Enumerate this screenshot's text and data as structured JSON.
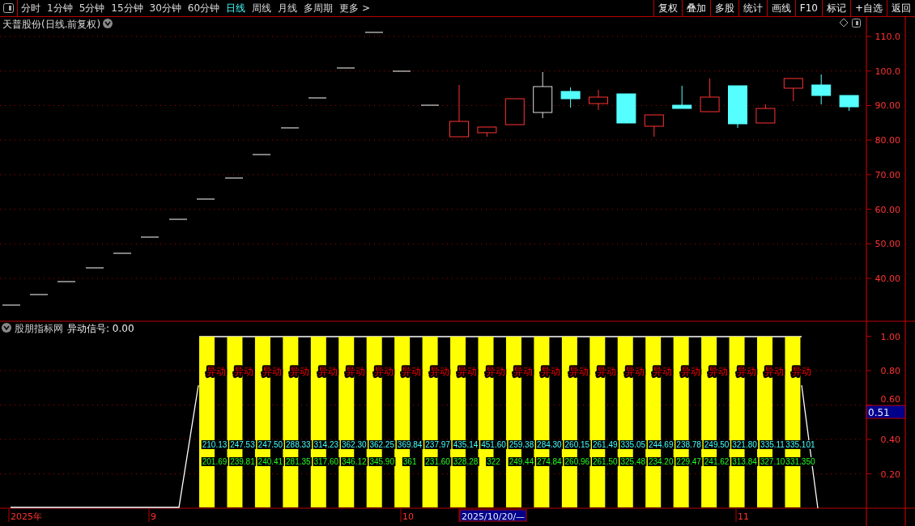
{
  "toolbar": {
    "periods": [
      {
        "label": "分时",
        "selected": false
      },
      {
        "label": "1分钟",
        "selected": false
      },
      {
        "label": "5分钟",
        "selected": false
      },
      {
        "label": "15分钟",
        "selected": false
      },
      {
        "label": "30分钟",
        "selected": false
      },
      {
        "label": "60分钟",
        "selected": false
      },
      {
        "label": "日线",
        "selected": true
      },
      {
        "label": "周线",
        "selected": false
      },
      {
        "label": "月线",
        "selected": false
      },
      {
        "label": "多周期",
        "selected": false
      },
      {
        "label": "更多 >",
        "selected": false
      }
    ],
    "actions": [
      "复权",
      "叠加",
      "多股",
      "统计",
      "画线",
      "F10",
      "标记",
      "+自选",
      "返回"
    ]
  },
  "main_chart": {
    "title": "天普股份(日线.前复权)",
    "price_axis": [
      "110.0",
      "100.0",
      "90.00",
      "80.00",
      "70.00",
      "60.00",
      "50.00",
      "40.00"
    ]
  },
  "indicator": {
    "source": "股朋指标网",
    "signal": "异动信号: 0.00",
    "axis": [
      "1.00",
      "0.80",
      "0.60",
      "0.40",
      "0.20"
    ],
    "cursor_value": "0.51",
    "bars": [
      {
        "tag": "异动",
        "value_1": "210.13",
        "value_2": "201.69"
      },
      {
        "tag": "异动",
        "value_1": "247.53",
        "value_2": "239.81"
      },
      {
        "tag": "异动",
        "value_1": "247.50",
        "value_2": "240.41"
      },
      {
        "tag": "异动",
        "value_1": "288.33",
        "value_2": "281.35"
      },
      {
        "tag": "异动",
        "value_1": "314.23",
        "value_2": "317.60"
      },
      {
        "tag": "异动",
        "value_1": "362.30",
        "value_2": "346.12"
      },
      {
        "tag": "异动",
        "value_1": "362.25",
        "value_2": "345.90"
      },
      {
        "tag": "异动",
        "value_1": "369.84",
        "value_2": "361"
      },
      {
        "tag": "异动",
        "value_1": "237.97",
        "value_2": "231.60"
      },
      {
        "tag": "异动",
        "value_1": "435.14",
        "value_2": "328.28"
      },
      {
        "tag": "异动",
        "value_1": "451.60",
        "value_2": "322"
      },
      {
        "tag": "异动",
        "value_1": "259.38",
        "value_2": "249.44"
      },
      {
        "tag": "异动",
        "value_1": "284.30",
        "value_2": "274.84"
      },
      {
        "tag": "异动",
        "value_1": "260.15",
        "value_2": "260.96"
      },
      {
        "tag": "异动",
        "value_1": "261.49",
        "value_2": "261.50"
      },
      {
        "tag": "异动",
        "value_1": "335.05",
        "value_2": "325.48"
      },
      {
        "tag": "异动",
        "value_1": "244.69",
        "value_2": "234.20"
      },
      {
        "tag": "异动",
        "value_1": "238.78",
        "value_2": "229.47"
      },
      {
        "tag": "异动",
        "value_1": "249.50",
        "value_2": "241.62"
      },
      {
        "tag": "异动",
        "value_1": "321.80",
        "value_2": "313.84"
      },
      {
        "tag": "异动",
        "value_1": "335.11",
        "value_2": "327.10"
      },
      {
        "tag": "异动",
        "value_1": "335.101",
        "value_2": "331.350"
      }
    ]
  },
  "date_axis": {
    "labels": [
      {
        "text": "2025年",
        "kind": "label"
      },
      {
        "text": "9",
        "kind": "label"
      },
      {
        "text": "10",
        "kind": "label"
      },
      {
        "text": "2025/10/20/—",
        "kind": "cursor"
      },
      {
        "text": "11",
        "kind": "label"
      }
    ]
  }
}
